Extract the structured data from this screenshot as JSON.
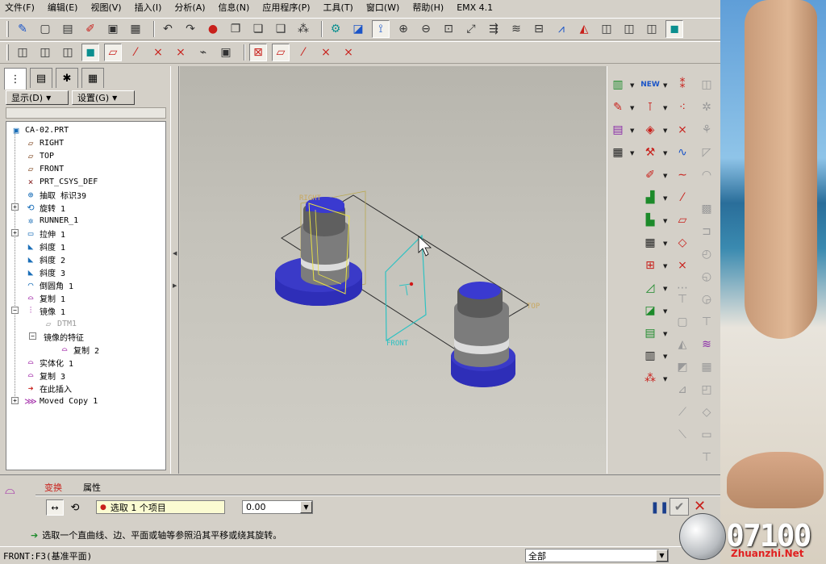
{
  "menu": [
    "文件(F)",
    "编辑(E)",
    "视图(V)",
    "插入(I)",
    "分析(A)",
    "信息(N)",
    "应用程序(P)",
    "工具(T)",
    "窗口(W)",
    "帮助(H)",
    "EMX 4.1"
  ],
  "panel": {
    "dropdown_show": "显示(D)",
    "dropdown_settings": "设置(G)"
  },
  "tree": [
    {
      "label": "CA-02.PRT",
      "icon": "part-icon"
    },
    {
      "label": "RIGHT",
      "icon": "datum-plane-icon"
    },
    {
      "label": "TOP",
      "icon": "datum-plane-icon"
    },
    {
      "label": "FRONT",
      "icon": "datum-plane-icon"
    },
    {
      "label": "PRT_CSYS_DEF",
      "icon": "csys-icon"
    },
    {
      "label": "抽取 标识39",
      "icon": "extract-icon"
    },
    {
      "label": "旋转 1",
      "icon": "revolve-icon"
    },
    {
      "label": "RUNNER_1",
      "icon": "runner-icon"
    },
    {
      "label": "拉伸 1",
      "icon": "extrude-icon"
    },
    {
      "label": "斜度 1",
      "icon": "draft-icon"
    },
    {
      "label": "斜度 2",
      "icon": "draft-icon"
    },
    {
      "label": "斜度 3",
      "icon": "draft-icon"
    },
    {
      "label": "倒圆角 1",
      "icon": "round-icon"
    },
    {
      "label": "复制 1",
      "icon": "copy-icon"
    },
    {
      "label": "镜像 1",
      "icon": "mirror-icon"
    },
    {
      "label": "DTM1",
      "icon": "datum-plane-icon"
    },
    {
      "label": "镜像的特征",
      "icon": ""
    },
    {
      "label": "复制 2",
      "icon": "copy-icon"
    },
    {
      "label": "实体化 1",
      "icon": "solidify-icon"
    },
    {
      "label": "复制 3",
      "icon": "copy-icon"
    },
    {
      "label": "在此插入",
      "icon": "insert-here-icon"
    },
    {
      "label": "Moved Copy 1",
      "icon": "moved-copy-icon"
    }
  ],
  "viewport": {
    "label_right": "RIGHT",
    "label_top": "TOP",
    "label_front": "FRONT"
  },
  "dashboard": {
    "tab_transform": "变换",
    "tab_properties": "属性",
    "collector": "选取 1 个项目",
    "value": "0.00",
    "message": "选取一个直曲线、边、平面或轴等参照沿其平移或绕其旋转。"
  },
  "status": {
    "selection": "FRONT:F3(基准平面)",
    "filter": "全部"
  },
  "watermark": {
    "number": "07100",
    "site": "Zhuanzhi.Net"
  },
  "colors": {
    "accent_red": "#c8201b",
    "tree_text": "#000000",
    "viewport_bg": "#c4c2ba",
    "model_blue": "#2e2eb8"
  }
}
